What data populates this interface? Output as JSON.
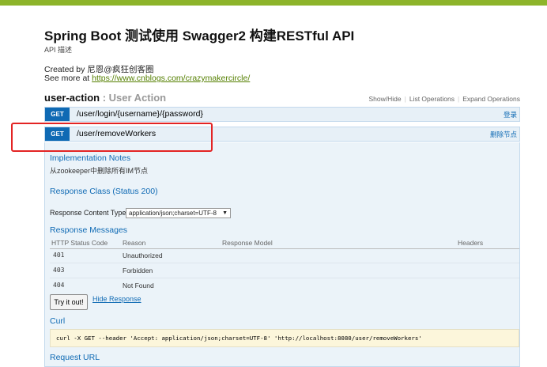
{
  "colors": {
    "brand_bar": "#8db42a",
    "get_verb": "#0f6ab4",
    "op_bg": "#e7f0f7",
    "link": "#547f00",
    "highlight": "#e32424",
    "curl_bg": "#fcf6db"
  },
  "info": {
    "title": "Spring Boot 测试使用 Swagger2 构建RESTful API",
    "description": "API 描述",
    "created_by": "Created by 尼恩@疯狂创客圈",
    "see_more_prefix": "See more at ",
    "see_more_link": "https://www.cnblogs.com/crazymakercircle/"
  },
  "resource": {
    "name": "user-action",
    "separator": " : ",
    "description": "User Action",
    "ops": {
      "show_hide": "Show/Hide",
      "list_operations": "List Operations",
      "expand_operations": "Expand Operations",
      "divider": "|"
    }
  },
  "operations": [
    {
      "method": "GET",
      "path": "/user/login/{username}/{password}",
      "summary": "登录"
    },
    {
      "method": "GET",
      "path": "/user/removeWorkers",
      "summary": "删除节点"
    }
  ],
  "expanded": {
    "implementation_notes_label": "Implementation Notes",
    "implementation_notes": "从zookeeper中删除所有IM节点",
    "response_class_label": "Response Class (Status 200)",
    "response_content_type_label": "Response Content Type",
    "response_content_type_value": "application/json;charset=UTF-8",
    "response_messages_label": "Response Messages",
    "table_headers": [
      "HTTP Status Code",
      "Reason",
      "Response Model",
      "Headers"
    ],
    "table_rows": [
      {
        "code": "401",
        "reason": "Unauthorized"
      },
      {
        "code": "403",
        "reason": "Forbidden"
      },
      {
        "code": "404",
        "reason": "Not Found"
      }
    ],
    "try_button": "Try it out!",
    "hide_response": "Hide Response",
    "curl_label": "Curl",
    "curl_command": "curl -X GET --header 'Accept: application/json;charset=UTF-8' 'http://localhost:8080/user/removeWorkers'",
    "request_url_label": "Request URL"
  }
}
